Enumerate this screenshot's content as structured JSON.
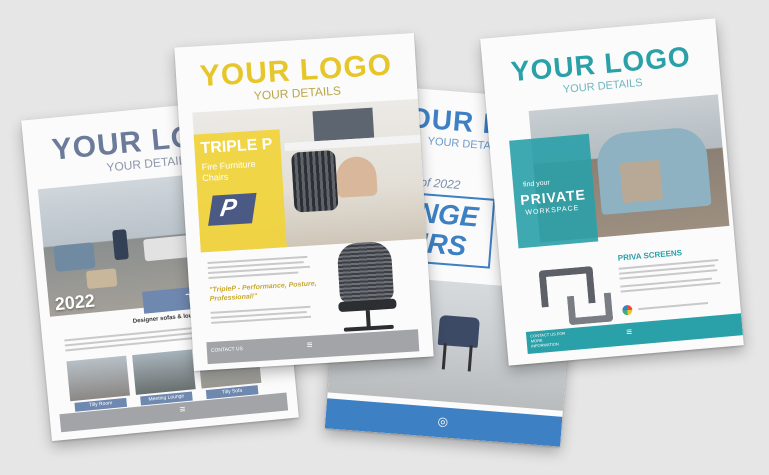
{
  "brochures": [
    {
      "id": "tilly",
      "logo": "YOUR LOGO",
      "details": "YOUR DETAILS",
      "year": "2022",
      "product": "Tilly",
      "tagline": "Designer sofas & lounge",
      "thumb_labels": [
        "Tilly Room",
        "Meeting Lounge",
        "Tilly Sofa"
      ],
      "footer_mark": "≡"
    },
    {
      "id": "triple-p",
      "logo": "YOUR LOGO",
      "details": "YOUR DETAILS",
      "headline": "TRIPLE P",
      "subheadline": "Fire Furniture Chairs",
      "badge": "P",
      "quote": "\"TripleP - Performance, Posture, Professional!\"",
      "contact": "CONTACT US",
      "footer_mark": "≡"
    },
    {
      "id": "lounge",
      "logo": "YOUR LOGO",
      "details": "YOUR DETAILS",
      "year_text": "of 2022",
      "headline_1": "NGE",
      "headline_2": "IRS",
      "footer_mark": "◎"
    },
    {
      "id": "priva",
      "logo": "YOUR LOGO",
      "details": "YOUR DETAILS",
      "kicker": "find your",
      "headline": "PRIVATE",
      "subheadline": "WORKSPACE",
      "section_title": "PRIVA SCREENS",
      "contact": "CONTACT US FOR MORE INFORMATION",
      "footer_mark": "≡"
    }
  ],
  "colors": {
    "background": "#e6e6e7",
    "tilly_logo": "#6b7b99",
    "tilly_banner": "#6f88b0",
    "triple_logo": "#e6c62a",
    "triple_yellow": "#f1d43a",
    "lounge_blue": "#3d80c4",
    "priva_teal": "#2aa0a8"
  },
  "icons": [
    "chair-icon",
    "screen-icon",
    "award-badge-icon"
  ]
}
